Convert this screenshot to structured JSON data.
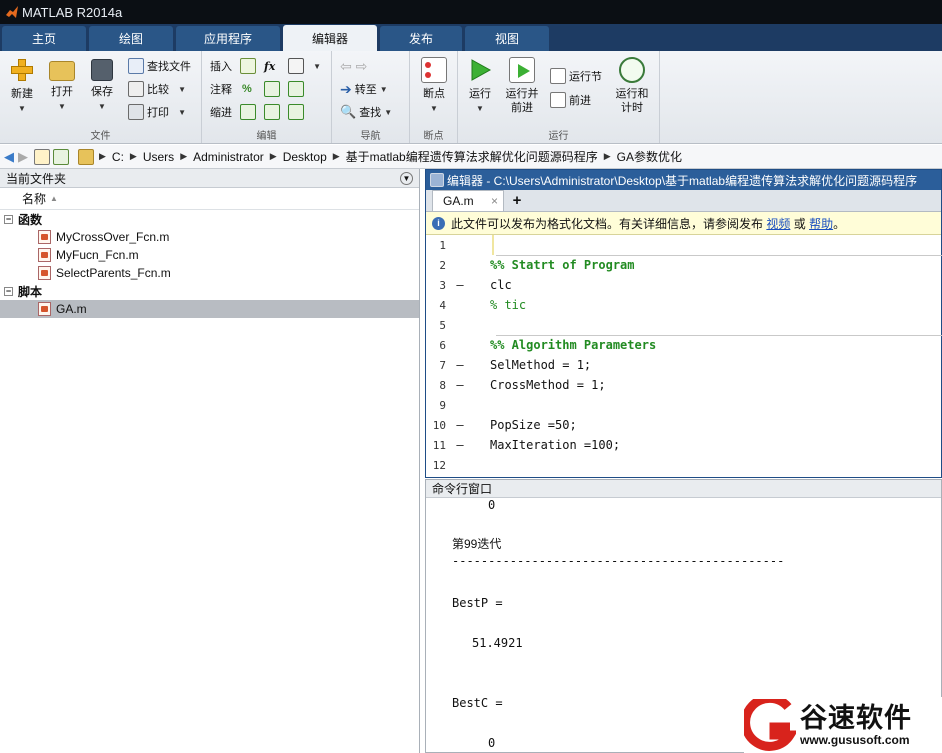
{
  "window": {
    "title": "MATLAB R2014a"
  },
  "tabs": [
    {
      "label": "主页"
    },
    {
      "label": "绘图"
    },
    {
      "label": "应用程序"
    },
    {
      "label": "编辑器"
    },
    {
      "label": "发布"
    },
    {
      "label": "视图"
    }
  ],
  "ribbon": {
    "file": {
      "label": "文件",
      "new": "新建",
      "open": "打开",
      "save": "保存",
      "find_files": "查找文件",
      "compare": "比较",
      "print": "打印"
    },
    "edit": {
      "label": "编辑",
      "insert": "插入",
      "comment": "注释",
      "indent": "缩进",
      "fx": "fx"
    },
    "nav": {
      "label": "导航",
      "goto": "转至",
      "find": "查找"
    },
    "bp": {
      "label": "断点",
      "breakpoints": "断点"
    },
    "run": {
      "label": "运行",
      "run": "运行",
      "run_advance_1": "运行并",
      "run_advance_2": "前进",
      "run_section": "运行节",
      "advance": "前进",
      "run_time_1": "运行和",
      "run_time_2": "计时"
    }
  },
  "address": {
    "crumbs": [
      "C:",
      "Users",
      "Administrator",
      "Desktop",
      "基于matlab编程遗传算法求解优化问题源码程序",
      "GA参数优化"
    ]
  },
  "current_folder": {
    "title": "当前文件夹",
    "column": "名称",
    "groups": [
      {
        "label": "函数",
        "items": [
          "MyCrossOver_Fcn.m",
          "MyFucn_Fcn.m",
          "SelectParents_Fcn.m"
        ]
      },
      {
        "label": "脚本",
        "items": [
          "GA.m"
        ]
      }
    ]
  },
  "editor": {
    "title": "编辑器 - C:\\Users\\Administrator\\Desktop\\基于matlab编程遗传算法求解优化问题源码程序",
    "tab": "GA.m",
    "close": "×",
    "add": "+",
    "info_text": "此文件可以发布为格式化文档。有关详细信息，请参阅发布",
    "info_link1": "视频",
    "info_or": "或",
    "info_link2": "帮助",
    "info_end": "。",
    "lines": [
      {
        "n": "1",
        "dash": "",
        "code": "",
        "style": "plain"
      },
      {
        "n": "2",
        "dash": "",
        "code": "%% Statrt of Program",
        "style": "sec"
      },
      {
        "n": "3",
        "dash": "—",
        "code": "clc",
        "style": "plain"
      },
      {
        "n": "4",
        "dash": "",
        "code": "% tic",
        "style": "cm"
      },
      {
        "n": "5",
        "dash": "",
        "code": "",
        "style": "plain"
      },
      {
        "n": "6",
        "dash": "",
        "code": "%% Algorithm Parameters",
        "style": "sec"
      },
      {
        "n": "7",
        "dash": "—",
        "code": "SelMethod = 1;",
        "style": "plain"
      },
      {
        "n": "8",
        "dash": "—",
        "code": "CrossMethod = 1;",
        "style": "plain"
      },
      {
        "n": "9",
        "dash": "",
        "code": "",
        "style": "plain"
      },
      {
        "n": "10",
        "dash": "—",
        "code": "PopSize =50;",
        "style": "plain"
      },
      {
        "n": "11",
        "dash": "—",
        "code": "MaxIteration =100;",
        "style": "plain"
      },
      {
        "n": "12",
        "dash": "",
        "code": "",
        "style": "plain"
      }
    ]
  },
  "command_window": {
    "title": "命令行窗口",
    "lines": [
      "0",
      "第99迭代",
      "----------------------------------------------",
      "BestP =",
      "51.4921",
      "BestC =",
      "0"
    ]
  },
  "watermark": {
    "brand": "谷速软件",
    "url": "www.gususoft.com"
  },
  "colors": {
    "title_bg": "#0b0f14",
    "tabs_bg": "#1d3b63",
    "accent": "#2b5e9a",
    "comment": "#228b22",
    "brand_red": "#d8231c"
  }
}
